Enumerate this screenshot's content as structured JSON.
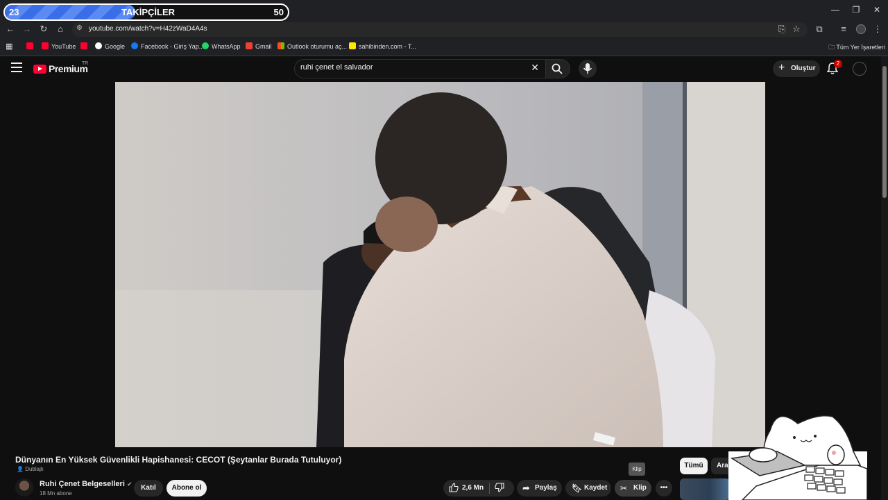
{
  "overlay": {
    "followers_current": "23",
    "followers_label": "TAKİPÇİLER",
    "followers_goal": "50",
    "progress_fraction": 0.46
  },
  "browser": {
    "url": "youtube.com/watch?v=H42zWaD4A4s",
    "bookmarks": [
      {
        "label": "YouTube"
      },
      {
        "label": "Google"
      },
      {
        "label": "Facebook - Giriş Yap..."
      },
      {
        "label": "WhatsApp"
      },
      {
        "label": "Gmail"
      },
      {
        "label": "Outlook oturumu aç..."
      },
      {
        "label": "sahibinden.com - T..."
      }
    ],
    "all_bookmarks": "Tüm Yer İşaretleri"
  },
  "yt": {
    "logo": "Premium",
    "logo_region": "TR",
    "search_query": "ruhi çenet el salvador",
    "create_label": "Oluştur",
    "notification_count": "2"
  },
  "video": {
    "title": "Dünyanın En Yüksek Güvenlikli Hapishanesi: CECOT (Şeytanlar Burada Tutuluyor)",
    "dubbed_label": "Dublajlı",
    "channel_name": "Ruhi Çenet Belgeselleri",
    "subscribers": "18 Mn abone",
    "join_label": "Katıl",
    "subscribe_label": "Abone ol",
    "likes": "2,6 Mn",
    "share_label": "Paylaş",
    "save_label": "Kaydet",
    "clip_label": "Klip",
    "clip_tooltip": "Klip"
  },
  "sidebar": {
    "chips": [
      "Tümü",
      "Aran"
    ]
  },
  "colors": {
    "brand_red": "#ff0033",
    "follower_bar": "#3a6ee8",
    "page_bg": "#0f0f0f"
  }
}
